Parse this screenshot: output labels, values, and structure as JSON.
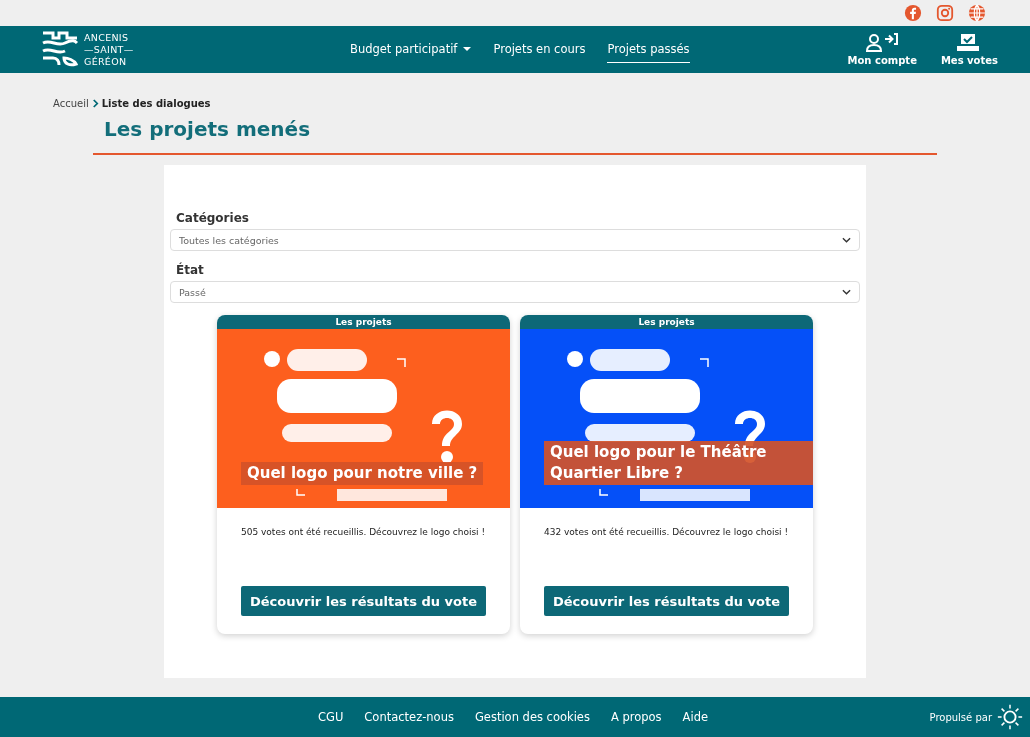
{
  "logo": {
    "lines": [
      "ANCENIS",
      "—SAINT—",
      "GÉRÉON"
    ]
  },
  "nav": [
    {
      "label": "Budget participatif",
      "dropdown": true,
      "selected": false
    },
    {
      "label": "Projets en cours",
      "dropdown": false,
      "selected": false
    },
    {
      "label": "Projets passés",
      "dropdown": false,
      "selected": true
    }
  ],
  "account": [
    {
      "kind": "account",
      "label": "Mon compte"
    },
    {
      "kind": "votes",
      "label": "Mes votes"
    }
  ],
  "social": [
    {
      "kind": "facebook"
    },
    {
      "kind": "instagram"
    },
    {
      "kind": "web"
    }
  ],
  "breadcrumb": [
    "Accueil",
    "Liste des dialogues"
  ],
  "title": "Les projets menés",
  "filters": [
    {
      "label": "Catégories",
      "value": "Toutes les catégories"
    },
    {
      "label": "État",
      "value": "Passé"
    }
  ],
  "cards": [
    {
      "header": "Les projets",
      "title": "Quel logo pour notre ville ?",
      "text": "505 votes ont été recueillis. Découvrez le logo choisi !",
      "button": "Découvrir les résultats du vote"
    },
    {
      "header": "Les projets",
      "title": "Quel logo pour le Théâtre Quartier Libre ?",
      "text": "432 votes ont été recueillis. Découvrez le logo choisi !",
      "button": "Découvrir les résultats du vote"
    }
  ],
  "footer": {
    "links": [
      "CGU",
      "Contactez-nous",
      "Gestion des cookies",
      "A propos",
      "Aide"
    ],
    "powered": "Propulsé par"
  }
}
